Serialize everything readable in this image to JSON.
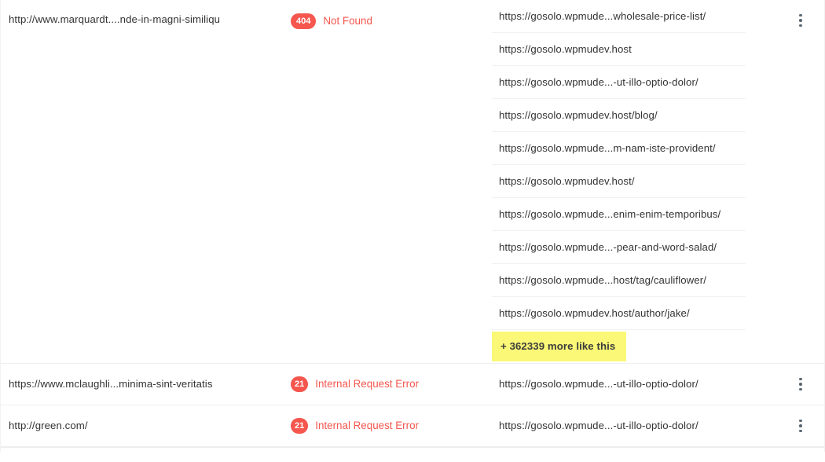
{
  "table": {
    "rows": [
      {
        "source_url": "http://www.marquardt....nde-in-magni-similiqu",
        "status_code": "404",
        "status_text": "Not Found",
        "destinations": [
          "https://gosolo.wpmude...wholesale-price-list/",
          "https://gosolo.wpmudev.host",
          "https://gosolo.wpmude...-ut-illo-optio-dolor/",
          "https://gosolo.wpmudev.host/blog/",
          "https://gosolo.wpmude...m-nam-iste-provident/",
          "https://gosolo.wpmudev.host/",
          "https://gosolo.wpmude...enim-enim-temporibus/",
          "https://gosolo.wpmude...-pear-and-word-salad/",
          "https://gosolo.wpmude...host/tag/cauliflower/",
          "https://gosolo.wpmudev.host/author/jake/"
        ],
        "more_link": "+ 362339 more like this",
        "actions_label": "Row actions"
      },
      {
        "source_url": "https://www.mclaughli...minima-sint-veritatis",
        "status_code": "21",
        "status_text": "Internal Request Error",
        "destinations": [
          "https://gosolo.wpmude...-ut-illo-optio-dolor/"
        ],
        "more_link": null,
        "actions_label": "Row actions"
      },
      {
        "source_url": "http://green.com/",
        "status_code": "21",
        "status_text": "Internal Request Error",
        "destinations": [
          "https://gosolo.wpmude...-ut-illo-optio-dolor/"
        ],
        "more_link": null,
        "actions_label": "Row actions"
      }
    ]
  },
  "colors": {
    "error_red": "#f5564e",
    "highlight_yellow": "#faf876",
    "text_dark": "#333333",
    "row_border": "#eceef0",
    "sub_border": "#f0f1f2"
  },
  "icons": {
    "kebab": "more-vertical-icon"
  }
}
